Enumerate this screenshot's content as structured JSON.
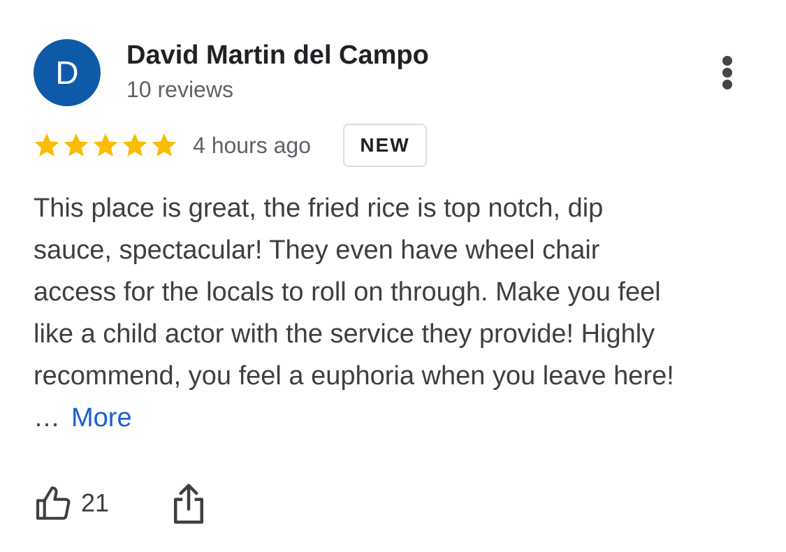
{
  "author": {
    "initial": "D",
    "name": "David Martin del Campo",
    "review_count": "10 reviews",
    "avatar_color": "#0f5aa8"
  },
  "rating": {
    "stars": 5,
    "max_stars": 5,
    "star_color": "#fbbc04",
    "icon": "star-icon"
  },
  "time_ago": "4 hours ago",
  "badge": "NEW",
  "review": {
    "lines": [
      "This place is great, the fried rice is top notch, dip",
      "sauce, spectacular! They even have wheel chair",
      "access for the locals to roll on through. Make you feel",
      "like a child actor with the service they provide! Highly",
      "recommend, you feel a euphoria when you leave here!"
    ],
    "ellipsis": "…",
    "more_label": "More",
    "more_color": "#1a5fd1"
  },
  "actions": {
    "like_icon": "thumbs-up-icon",
    "like_count": "21",
    "share_icon": "share-icon",
    "menu_icon": "more-vert-icon"
  }
}
